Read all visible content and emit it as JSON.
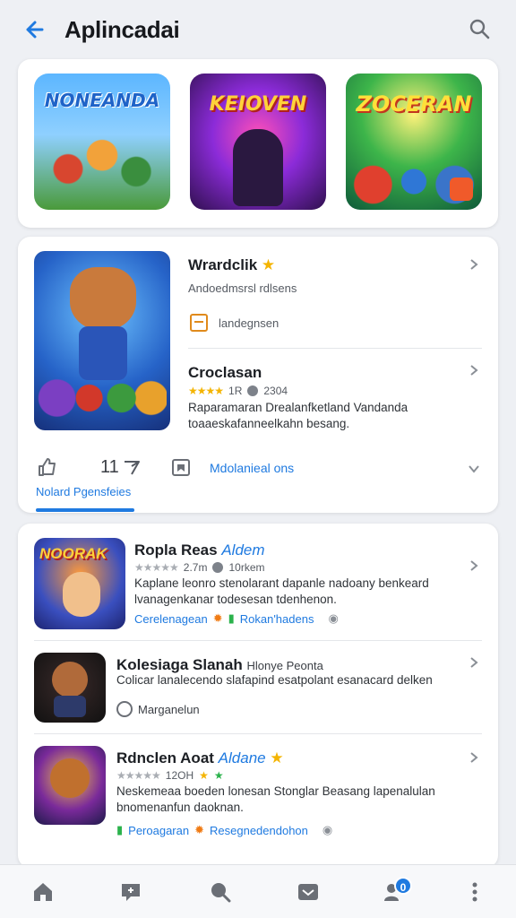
{
  "header": {
    "title": "Aplincadai"
  },
  "banner": {
    "tiles": [
      {
        "text": "NONEANDA"
      },
      {
        "text": "KEIOVEN"
      },
      {
        "text": "ZOCERAN"
      }
    ]
  },
  "featured": {
    "item1": {
      "title": "Wrardclik",
      "subtitle": "Andoedmsrsl rdlsens",
      "tag": "landegnsen"
    },
    "item2": {
      "title": "Croclasan",
      "rating": "★★★★",
      "count": "1R",
      "downloads": "2304",
      "desc": "Raparamaran Drealanfketland Vandanda toaaeskafanneelkahn besang."
    },
    "actions": {
      "likes": "11",
      "manage": "Mdolanieal ons",
      "bottom_link": "Nolard Pgensfeies"
    }
  },
  "list": [
    {
      "title": "Ropla Reas",
      "title_accent": "Aldem",
      "rating_text": "2.7m",
      "downloads": "10rkem",
      "desc": "Kaplane leonro stenolarant dapanle nadoany benkeard lvanagenkanar todesesan tdenhenon.",
      "link1": "Cerelenagean",
      "link2": "Rokan'hadens"
    },
    {
      "title": "Kolesiaga Slanah",
      "title_extra": "Hlonye Peonta",
      "desc": "Colicar lanalecendo slafapind esatpolant esanacard delken",
      "tag": "Marganelun"
    },
    {
      "title": "Rdnclen Aoat",
      "title_accent": "Aldane",
      "rating_text": "12OH",
      "desc": "Neskemeaa boeden lonesan Stonglar Beasang lapenalulan bnomenanfun daoknan.",
      "link1": "Peroagaran",
      "link2": "Resegnedendohon"
    }
  ],
  "colors": {
    "accent": "#1f7ae0",
    "star": "#f4b400",
    "green": "#2bb24c",
    "orange": "#f07b14"
  }
}
